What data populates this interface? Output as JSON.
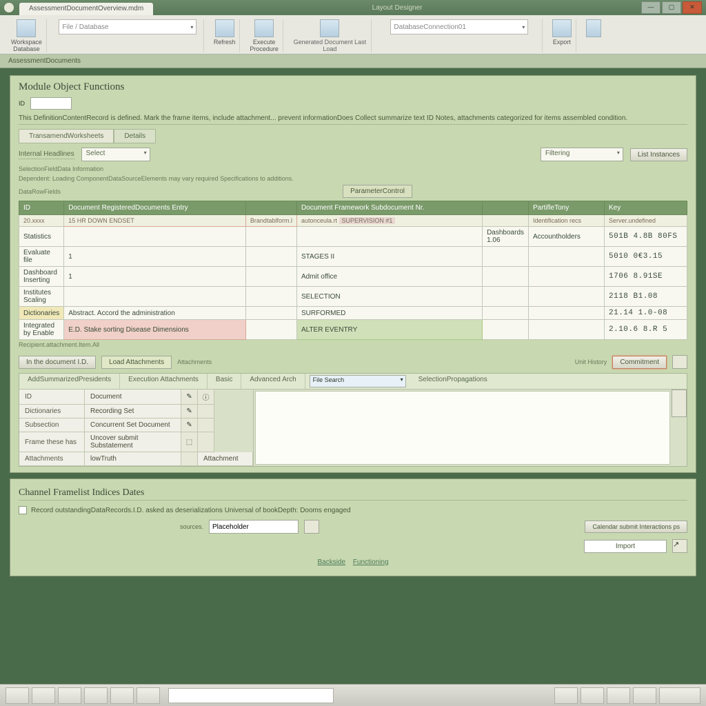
{
  "window": {
    "tab_title": "AssessmentDocumentOverview.mdm",
    "center_label": "Layout Designer",
    "min": "—",
    "max": "▢",
    "close": "✕"
  },
  "ribbon": {
    "g1_label": "Workspace",
    "g1_sub": "Database",
    "combo1": "File / Database",
    "g2_label": "Refresh",
    "g3_label": "Execute",
    "g3_sub": "Procedure",
    "g4_sub": "Generated Document Last Load",
    "combo2": "DatabaseConnection01",
    "g5_label": "Export"
  },
  "breadcrumb": "AssessmentDocuments",
  "main": {
    "title": "Module Object Functions",
    "small_label": "ID",
    "desc": "This DefinitionContentRecord is defined. Mark the frame items, include attachment... prevent informationDoes Collect summarize text ID Notes, attachments categorized for items assembled condition.",
    "tabs": [
      "TransamendWorksheets",
      "Details"
    ],
    "tab_filter_label": "Internal Headlines",
    "tab_filter_value": "Select",
    "right_dd": "Filtering",
    "right_btn": "List Instances",
    "hint_title": "SelectionFieldData Information",
    "hint_text": "Dependent: Loading ComponentDataSourceElements may vary required Specifications to additions.",
    "hint_small": "DataRowFields",
    "center_btn": "ParameterControl"
  },
  "table": {
    "headers": [
      "ID",
      "Document RegisteredDocuments Entry",
      "",
      "Document Framework Subdocument Nr.",
      "",
      "PartifleTony",
      "Key"
    ],
    "sub": [
      "20.xxxx",
      "15 HR DOWN ENDSET",
      "Brandtablform.l",
      "autonceula.rt",
      "SUPERVISION #1",
      "",
      "Identification recs",
      "Server.undefined"
    ],
    "rows": [
      {
        "c0": "Statistics",
        "c1": "",
        "c2": "",
        "c3": "",
        "c4": "Dashboards 1.06",
        "c5": "Accountholders",
        "c6": "501B 4.8B 80FS"
      },
      {
        "c0": "Evaluate file",
        "c1": "1",
        "c2": "",
        "c3": "STAGES II",
        "c4": "",
        "c5": "",
        "c6": "5010 0€3.15"
      },
      {
        "c0": "Dashboard Inserting",
        "c1": "1",
        "c2": "",
        "c3": "Admit office",
        "c4": "",
        "c5": "",
        "c6": "1706 8.91SE"
      },
      {
        "c0": "Institutes Scaling",
        "c1": "",
        "c2": "",
        "c3": "SELECTION",
        "c4": "",
        "c5": "",
        "c6": "2118 B1.08"
      },
      {
        "c0": "Dictionaries",
        "c1": "Abstract. Accord the administration",
        "c2": "",
        "c3": "SURFORMED",
        "c4": "",
        "c5": "",
        "c6": "21.14 1.0-08",
        "yel": true
      },
      {
        "c0": "Integrated by Enable",
        "c1": "E.D. Stake sorting Disease Dimensions",
        "c2": "",
        "c3": "ALTER EVENTRY",
        "c4": "",
        "c5": "",
        "c6": "2.10.6 8.R 5",
        "red": true
      }
    ],
    "footer_note": "Recipient.attachment.Item.All"
  },
  "actions": {
    "b1": "In the document I.D.",
    "b2": "Load Attachments",
    "b3": "Attachments",
    "b4": "Unit History",
    "b5": "Commitment"
  },
  "subtabs": {
    "t1": "AddSummarizedPresidents",
    "t2": "Execution Attachments",
    "t3": "Basic",
    "t4": "Advanced Arch",
    "dd": "File Search",
    "extra": "SelectionPropagations"
  },
  "props": {
    "r1k": "ID",
    "r1v": "Document",
    "r2k": "Dictionaries",
    "r2v": "Recording Set",
    "r3k": "Subsection",
    "r3v": "Concurrent Set Document",
    "r4k": "Frame these has",
    "r4v": "Uncover submit Substatement",
    "r5k": "Attachments",
    "r5v": "lowTruth",
    "r5v2": "Attachment"
  },
  "bottom": {
    "title": "Channel Framelist Indices Dates",
    "cb_label": "Record outstandingDataRecords.I.D. asked as deserializations Universal of bookDepth: Dooms engaged",
    "form_label": "sources.",
    "form_value": "Placeholder",
    "link_btn": "Calendar submit Interactions ps",
    "import_btn": "Import",
    "back": "Backside",
    "fwd": "Functioning"
  }
}
